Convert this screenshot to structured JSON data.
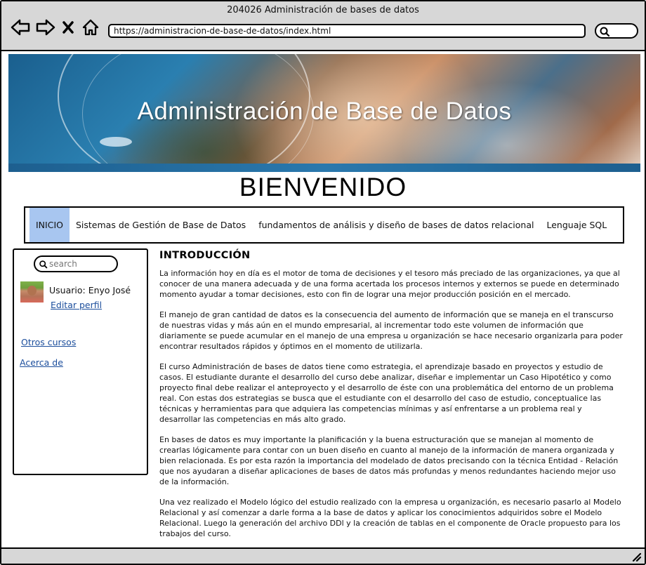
{
  "window": {
    "title": "204026 Administración de bases de datos",
    "url": "https://administracion-de-base-de-datos/index.html"
  },
  "icons": {
    "back": "back-arrow-icon",
    "forward": "forward-arrow-icon",
    "close": "close-icon",
    "home": "home-icon",
    "search": "search-icon",
    "resize": "resize-grip-icon"
  },
  "banner": {
    "title": "Administración de Base de Datos"
  },
  "welcome": "BIENVENIDO",
  "menu": {
    "items": [
      {
        "label": "INICIO",
        "active": true
      },
      {
        "label": "Sistemas de Gestión de Base de Datos",
        "active": false
      },
      {
        "label": "fundamentos de análisis y diseño de bases de datos relacional",
        "active": false
      },
      {
        "label": "Lenguaje SQL",
        "active": false
      }
    ],
    "active_color": "#a8c6f0"
  },
  "sidebar": {
    "search_placeholder": "search",
    "user_label": "Usuario: Enyo José",
    "edit_profile": "Editar perfil",
    "links": [
      "Otros cursos",
      "Acerca de"
    ],
    "link_color": "#1c4e9c"
  },
  "content": {
    "heading": "INTRODUCCIÓN",
    "paragraphs": [
      "La información hoy en día es el motor de toma de decisiones y el tesoro más preciado de las organizaciones, ya que al conocer de una manera adecuada y de una forma acertada los procesos internos y externos se puede en determinado momento ayudar a tomar decisiones, esto con fin de lograr una mejor producción posición en el mercado.",
      "El manejo de gran cantidad de datos es la consecuencia del aumento de información que se maneja en el transcurso de nuestras vidas y más aún en el mundo empresarial, al incrementar todo este volumen de información que diariamente se puede acumular en el manejo de una empresa u organización se hace necesario organizarla para poder encontrar resultados rápidos y óptimos en el momento de utilizarla.",
      "El curso Administración de bases de datos tiene como estrategia, el aprendizaje basado en proyectos y estudio de casos. El estudiante durante el desarrollo del curso debe analizar, diseñar e implementar un Caso Hipotético y como proyecto final debe realizar el anteproyecto y el desarrollo de éste con una problemática del entorno de un problema real. Con estas dos estrategias se busca que el estudiante con el desarrollo del caso de estudio, conceptualice las técnicas y herramientas para que adquiera las competencias mínimas y así enfrentarse a un problema real y desarrollar las competencias en más alto grado.",
      "En bases de datos es muy importante la planificación y la buena estructuración que se manejan al momento de crearlas  lógicamente para contar con un buen diseño en cuanto al manejo de la información de manera organizada y bien relacionada. Es por esta razón la importancia del modelado de datos precisando con la técnica Entidad - Relación que nos ayudaran a diseñar aplicaciones de bases de datos más profundas y menos redundantes haciendo mejor uso de la información.",
      "Una vez realizado el Modelo lógico del estudio realizado con la empresa u organización, es necesario pasarlo al Modelo Relacional y así comenzar a darle forma a la base de datos y aplicar los conocimientos adquiridos sobre el Modelo Relacional. Luego la generación del archivo DDl y la creación de tablas en el componente de Oracle propuesto para los trabajos del curso."
    ]
  }
}
